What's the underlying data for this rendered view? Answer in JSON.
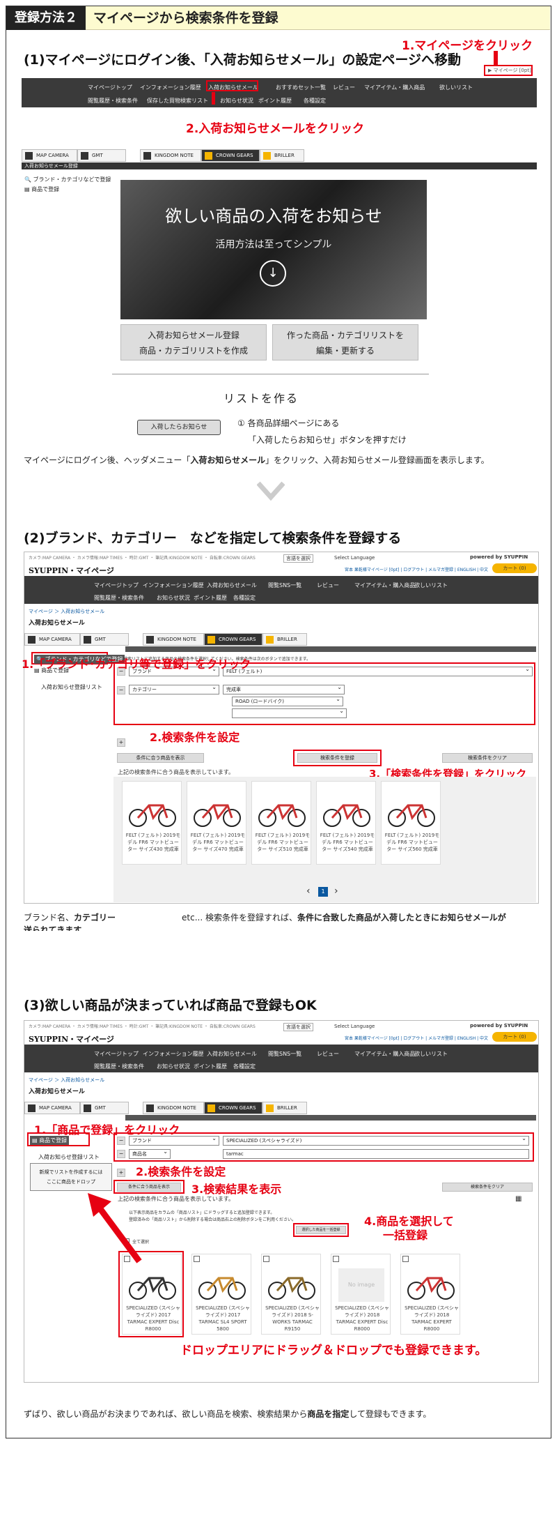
{
  "header": {
    "tag": "登録方法２",
    "title": "マイページから検索条件を登録"
  },
  "section1": {
    "heading": "(1)マイページにログイン後、「入荷お知らせメール」の設定ページへ移動",
    "callout1": "1.マイページをクリック",
    "callout2": "2.入荷お知らせメールをクリック",
    "mypage_link": "▶ マイページ [0pt]",
    "nav_row1": [
      "マイページトップ",
      "インフォメーション履歴",
      "入荷お知らせメール",
      "おすすめセット一覧",
      "レビュー",
      "マイアイテム・購入商品",
      "欲しいリスト"
    ],
    "nav_row2": [
      "閲覧履歴・検索条件",
      "保存した買物検索リスト",
      "お知らせ状況",
      "ポイント履歴",
      "各種設定"
    ],
    "tabs": [
      "MAP CAMERA",
      "GMT",
      "KINGDOM NOTE",
      "CROWN GEARS",
      "BRILLER"
    ],
    "page_label": "入荷お知らせメール登録",
    "side_items": [
      "ブランド・カテゴリなどで登録",
      "商品で登録"
    ],
    "hero_title": "欲しい商品の入荷をお知らせ",
    "hero_sub": "活用方法は至ってシンプル",
    "btn_left": [
      "入荷お知らせメール登録",
      "商品・カテゴリリストを作成"
    ],
    "btn_right": [
      "作った商品・カテゴリリストを",
      "編集・更新する"
    ],
    "list_title": "リストを作る",
    "notify_btn": "入荷したらお知らせ",
    "step_text1": "① 各商品詳細ページにある",
    "step_text2": "「入荷したらお知らせ」ボタンを押すだけ",
    "caption_pre": "マイページにログイン後、ヘッダメニュー「",
    "caption_bold": "入荷お知らせメール",
    "caption_post": "」をクリック、入荷お知らせメール登録画面を表示します。"
  },
  "section2": {
    "heading_pre": "(2)ブランド、",
    "heading_bold": "カテゴリー",
    "heading_post": "　などを指定して検索条件を登録する",
    "logo": "SYUPPIN・マイページ",
    "topbar": "カメラ:MAP CAMERA ・ カメラ情報:MAP TIMES ・ 時計:GMT ・ 筆記具:KINGDOM NOTE ・ 自転車:CROWN GEARS",
    "lang_select": "言語を選択",
    "lang_label": "Select Language",
    "powered": "powered by SYUPPIN",
    "account_links": "宮本 果乾様マイページ [0pt] | ログアウト | メルマガ登録 | ENGLISH | 中文",
    "cart": "カート (0)",
    "nav_row1": [
      "マイページトップ",
      "インフォメーション履歴",
      "入荷お知らせメール",
      "閲覧SNS一覧",
      "レビュー",
      "マイアイテム・購入商品",
      "欲しいリスト"
    ],
    "nav_row2": [
      "閲覧履歴・検索条件",
      "お知らせ状況",
      "ポイント履歴",
      "各種設定"
    ],
    "breadcrumb": "マイページ ＞ 入荷お知らせメール",
    "page_title": "入荷お知らせメール",
    "callout1": "1.「ブランド･カテゴリ等で登録」をクリック",
    "callout2": "2.検索条件を設定",
    "callout3": "3.「検索条件を登録」をクリック",
    "side_items": [
      "ブランド・カテゴリなどで登録",
      "商品で登録",
      "入荷お知らせ登録リスト"
    ],
    "info": "検索リストに追加する商品の検索条件を選択してください。検索条件は次のボタンで追加できます。",
    "brand_label": "ブランド",
    "brand_value": "FELT (フェルト)",
    "category_label": "カテゴリー",
    "category_value": "完成車",
    "sub_value": "ROAD (ロードバイク)",
    "show_btn": "条件に合う商品を表示",
    "register_btn": "検索条件を登録",
    "clear_btn": "検索条件をクリア",
    "result_note": "上記の検索条件に合う商品を表示しています。",
    "products": [
      "FELT (フェルト) 2019モデル FR6 マットビューター サイズ430 完成車",
      "FELT (フェルト) 2019モデル FR6 マットビューター サイズ470 完成車",
      "FELT (フェルト) 2019モデル FR6 マットビューター サイズ510 完成車",
      "FELT (フェルト) 2019モデル FR6 マットビューター サイズ540 完成車",
      "FELT (フェルト) 2019モデル FR6 マットビューター サイズ560 完成車"
    ],
    "page_num": "1",
    "caption_a": "ブランド名、",
    "caption_b": "カテゴリー",
    "caption_c": "etc... 検索条件を登録すれば、",
    "caption_d": "条件に合致した商品が入荷したときにお知らせメールが",
    "caption_e": "送られてきます。"
  },
  "section3": {
    "heading": "(3)欲しい商品が決まっていれば商品で登録もOK",
    "callout1": "1.「商品で登録」をクリック",
    "callout2": "2.検索条件を設定",
    "callout3": "3.検索結果を表示",
    "callout4a": "4.商品を選択して",
    "callout4b": "一括登録",
    "callout5": "ドロップエリアにドラッグ＆ドロップでも登録できます。",
    "side_items": [
      "商品で登録",
      "入荷お知らせ登録リスト"
    ],
    "drop_text1": "新規でリストを作成するには",
    "drop_text2": "ここに商品をドロップ",
    "brand_label": "ブランド",
    "brand_value": "SPECIALIZED (スペシャライズド)",
    "name_label": "商品名",
    "name_value": "tarmac",
    "show_btn": "条件に合う商品を表示",
    "clear_btn": "検索条件をクリア",
    "result_note": "上記の検索条件に合う商品を表示しています。",
    "hint1": "以下表示商品をカラムの「商品リスト」にドラッグすると追加登録できます。",
    "hint2": "登録済みの「商品リスト」から削除する場合は商品右上の削除ボタンをご利用ください。",
    "bulk_btn": "選択した商品を一括登録",
    "select_all": "全て選択",
    "products": [
      "SPECIALIZED (スペシャライズド) 2017 TARMAC EXPERT Disc R8000",
      "SPECIALIZED (スペシャライズド) 2017 TARMAC SL4 SPORT 5800",
      "SPECIALIZED (スペシャライズド) 2018 S-WORKS TARMAC R9150",
      "SPECIALIZED (スペシャライズド) 2018 TARMAC EXPERT Disc R8000",
      "SPECIALIZED (スペシャライズド) 2018 TARMAC EXPERT R8000"
    ],
    "no_image": "No image",
    "caption_pre": "ずばり、欲しい商品がお決まりであれば、欲しい商品を検索、検索結果から",
    "caption_bold": "商品を指定",
    "caption_post": "して登録もできます。"
  },
  "colors": {
    "accent": "#e60012",
    "nav": "#3a3a3a",
    "header_bg": "#fdfbd0",
    "cart": "#f5b400"
  }
}
